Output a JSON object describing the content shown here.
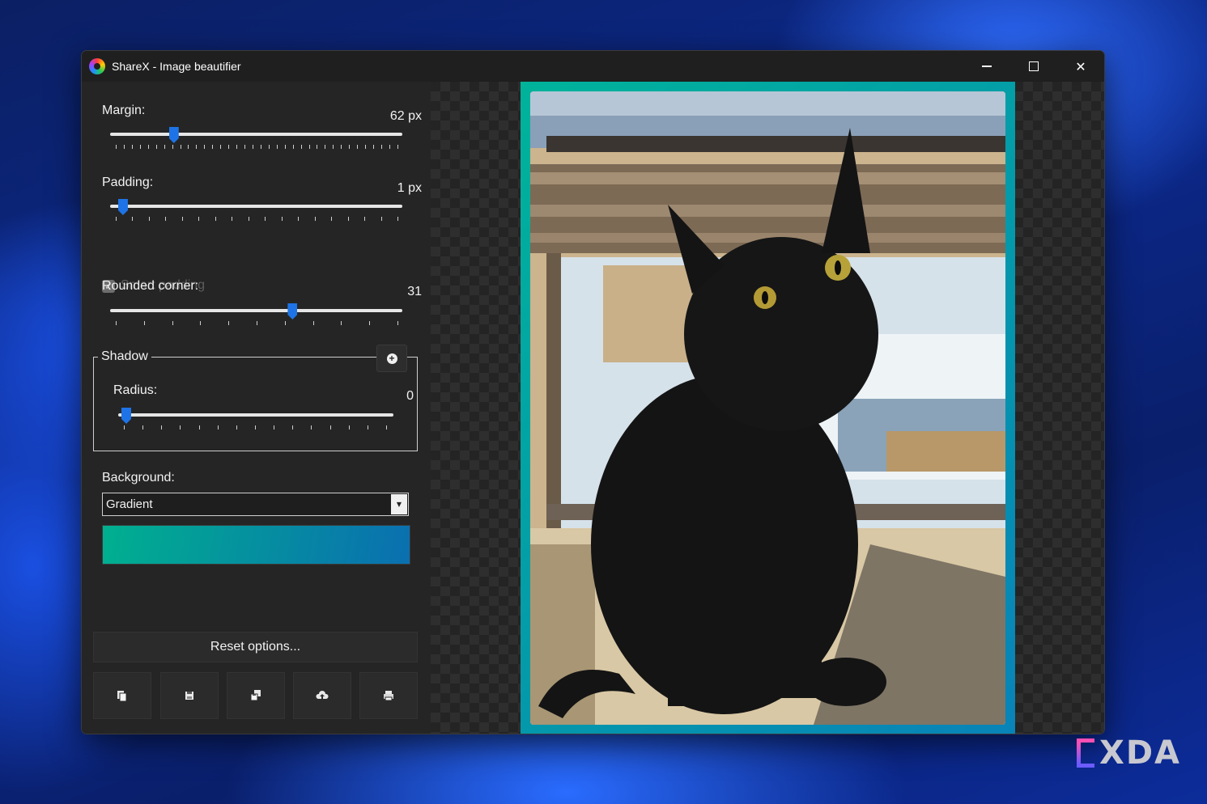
{
  "window": {
    "title": "ShareX - Image beautifier",
    "controls": {
      "minimize": "",
      "maximize": "",
      "close": "✕"
    }
  },
  "options": {
    "margin": {
      "label": "Margin:",
      "value_text": "62 px",
      "value_fraction": 0.2,
      "ticks": 36
    },
    "padding": {
      "label": "Padding:",
      "value_text": "1 px",
      "value_fraction": 0.02,
      "ticks": 18
    },
    "smart_padding": {
      "label": "Smart padding",
      "checked": true,
      "enabled": false
    },
    "rounded_corner": {
      "label": "Rounded corner:",
      "value_text": "31",
      "value_fraction": 0.62,
      "ticks": 11
    },
    "shadow": {
      "title": "Shadow",
      "add_symbol": "+",
      "radius": {
        "label": "Radius:",
        "value_text": "0",
        "value_fraction": 0.0,
        "ticks": 15
      }
    },
    "background": {
      "label": "Background:",
      "selected": "Gradient",
      "gradient_from": "#00b08f",
      "gradient_to": "#0a6fb0"
    }
  },
  "actions": {
    "reset_label": "Reset options...",
    "buttons": [
      "copy-icon",
      "save-icon",
      "save-as-icon",
      "upload-icon",
      "print-icon"
    ]
  },
  "preview": {
    "frame_from": "#00b39a",
    "frame_to": "#0883b8"
  },
  "watermark": {
    "text": "XDA"
  }
}
